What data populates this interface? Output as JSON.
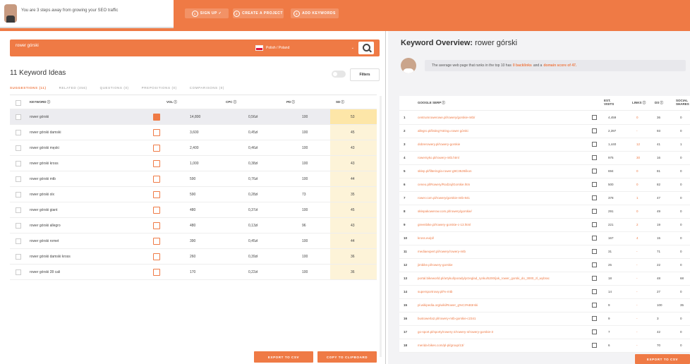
{
  "topbar": {
    "tagline": "You are 3 steps away from growing your SEO traffic",
    "steps": [
      {
        "num": "1",
        "label": "SIGN UP ✓"
      },
      {
        "num": "2",
        "label": "CREATE A PROJECT"
      },
      {
        "num": "3",
        "label": "ADD KEYWORDS"
      }
    ]
  },
  "search": {
    "value": "rower górski",
    "country": "Polish / Poland"
  },
  "ideas": {
    "title": "11 Keyword Ideas",
    "filters_label": "Filters",
    "tabs": [
      "SUGGESTIONS (11)",
      "RELATED (456)",
      "QUESTIONS (0)",
      "PREPOSITIONS (0)",
      "COMPARISONS (0)"
    ],
    "columns": {
      "keyword": "KEYWORD ⓘ",
      "vol": "VOL ⓘ",
      "cpc": "CPC ⓘ",
      "pd": "PD ⓘ",
      "sd": "SD ⓘ"
    },
    "rows": [
      {
        "keyword": "rower górski",
        "vol": "14,800",
        "cpc": "0,56zł",
        "pd": "100",
        "sd": "53"
      },
      {
        "keyword": "rower górski damski",
        "vol": "3,600",
        "cpc": "0,45zł",
        "pd": "100",
        "sd": "45"
      },
      {
        "keyword": "rower górski męski",
        "vol": "2,400",
        "cpc": "0,46zł",
        "pd": "100",
        "sd": "43"
      },
      {
        "keyword": "rower górski kross",
        "vol": "1,000",
        "cpc": "0,38zł",
        "pd": "100",
        "sd": "43"
      },
      {
        "keyword": "rower górski mtb",
        "vol": "590",
        "cpc": "0,76zł",
        "pd": "100",
        "sd": "44"
      },
      {
        "keyword": "rower górski olx",
        "vol": "590",
        "cpc": "0,28zł",
        "pd": "73",
        "sd": "35"
      },
      {
        "keyword": "rower górski giant",
        "vol": "480",
        "cpc": "0,37zł",
        "pd": "100",
        "sd": "45"
      },
      {
        "keyword": "rower górski allegro",
        "vol": "480",
        "cpc": "0,13zł",
        "pd": "96",
        "sd": "43"
      },
      {
        "keyword": "rower górski romet",
        "vol": "390",
        "cpc": "0,45zł",
        "pd": "100",
        "sd": "44"
      },
      {
        "keyword": "rower górski damski kross",
        "vol": "260",
        "cpc": "0,39zł",
        "pd": "100",
        "sd": "36"
      },
      {
        "keyword": "rower górski 28 cali",
        "vol": "170",
        "cpc": "0,22zł",
        "pd": "100",
        "sd": "36"
      }
    ],
    "export_csv": "EXPORT TO CSV",
    "copy_clipboard": "COPY TO CLIPBOARD"
  },
  "overview": {
    "title_prefix": "Keyword Overview:",
    "title_keyword": "rower górski",
    "summary_pre": "The average web page that ranks in the top 10 has",
    "summary_backlinks": "0 backlinks",
    "summary_mid": "and a",
    "summary_ds": "domain score of 47.",
    "columns": {
      "serp": "GOOGLE SERP ⓘ",
      "visits": "EST. VISITS",
      "links": "LINKS ⓘ",
      "ds": "DS ⓘ",
      "shares": "SOCIAL SHARES"
    },
    "rows": [
      {
        "rank": "1",
        "url": "centrumrowerowe.pl/rowery/gorskie-mtb/",
        "visits": "4,459",
        "links": "0",
        "ds": "36",
        "shares": "0"
      },
      {
        "rank": "2",
        "url": "allegro.pl/listing?string=rower górski",
        "visits": "2,397",
        "links": "-",
        "ds": "93",
        "shares": "0"
      },
      {
        "rank": "3",
        "url": "dobrerowery.pl/rowery-gorskie",
        "visits": "1,440",
        "links": "12",
        "ds": "41",
        "shares": "1"
      },
      {
        "rank": "4",
        "url": "rowersyko.pl/rowery-mtb.html",
        "visits": "975",
        "links": "30",
        "ds": "16",
        "shares": "0"
      },
      {
        "rank": "5",
        "url": "sklep.pl/filtering/a-rower-g9C39J8/ikon",
        "visits": "694",
        "links": "0",
        "ds": "81",
        "shares": "0"
      },
      {
        "rank": "6",
        "url": "ceneo.pl/Rowery/Rodzaj/Gorskie.htm",
        "visits": "500",
        "links": "0",
        "ds": "82",
        "shares": "0"
      },
      {
        "rank": "7",
        "url": "rower.com.pl/rowery/gorskie-mtb-841",
        "visits": "378",
        "links": "1",
        "ds": "47",
        "shares": "0"
      },
      {
        "rank": "8",
        "url": "sklepakowerow.com.pl/rowery/gorskie/",
        "visits": "291",
        "links": "0",
        "ds": "49",
        "shares": "0"
      },
      {
        "rank": "9",
        "url": "greenbike.pl/rowery-gorskie-c-13.html",
        "visits": "221",
        "links": "2",
        "ds": "19",
        "shares": "0"
      },
      {
        "rank": "10",
        "url": "kross.eu/pl/",
        "visits": "167",
        "links": "4",
        "ds": "15",
        "shares": "0"
      },
      {
        "rank": "11",
        "url": "mediaexpert.pl/rowery/rowery-mtb",
        "visits": "31",
        "links": "-",
        "ds": "71",
        "shares": "0"
      },
      {
        "rank": "12",
        "url": "jimbike.pl/rowery-gorskie",
        "visits": "25",
        "links": "-",
        "ds": "22",
        "shares": "0"
      },
      {
        "rank": "13",
        "url": "portal.bikeworld.pl/artykul/porady/przeglad_rynku/5200/jak_rower_gorski_do_3000_zl_wybrac",
        "visits": "18",
        "links": "-",
        "ds": "48",
        "shares": "68"
      },
      {
        "rank": "14",
        "url": "supersportrowy.pl/%-mtb",
        "visits": "14",
        "links": "-",
        "ds": "27",
        "shares": "0"
      },
      {
        "rank": "15",
        "url": "pl.wikipedia.org/wiki/Rower_g%C3%B3rski",
        "visits": "9",
        "links": "-",
        "ds": "100",
        "shares": "35"
      },
      {
        "rank": "16",
        "url": "bustowerla2.pl/rowery-mtb-gorskie-c2341",
        "visits": "9",
        "links": "-",
        "ds": "3",
        "shares": "0"
      },
      {
        "rank": "17",
        "url": "go-sport.pl/sporty/rowery-2/rowery-4/rowery-gorskie-3",
        "visits": "7",
        "links": "-",
        "ds": "42",
        "shares": "0"
      },
      {
        "rank": "18",
        "url": "merida-bikes.com/pl-pl/group/13/",
        "visits": "6",
        "links": "-",
        "ds": "70",
        "shares": "0"
      }
    ],
    "export_csv": "EXPORT TO CSV"
  }
}
